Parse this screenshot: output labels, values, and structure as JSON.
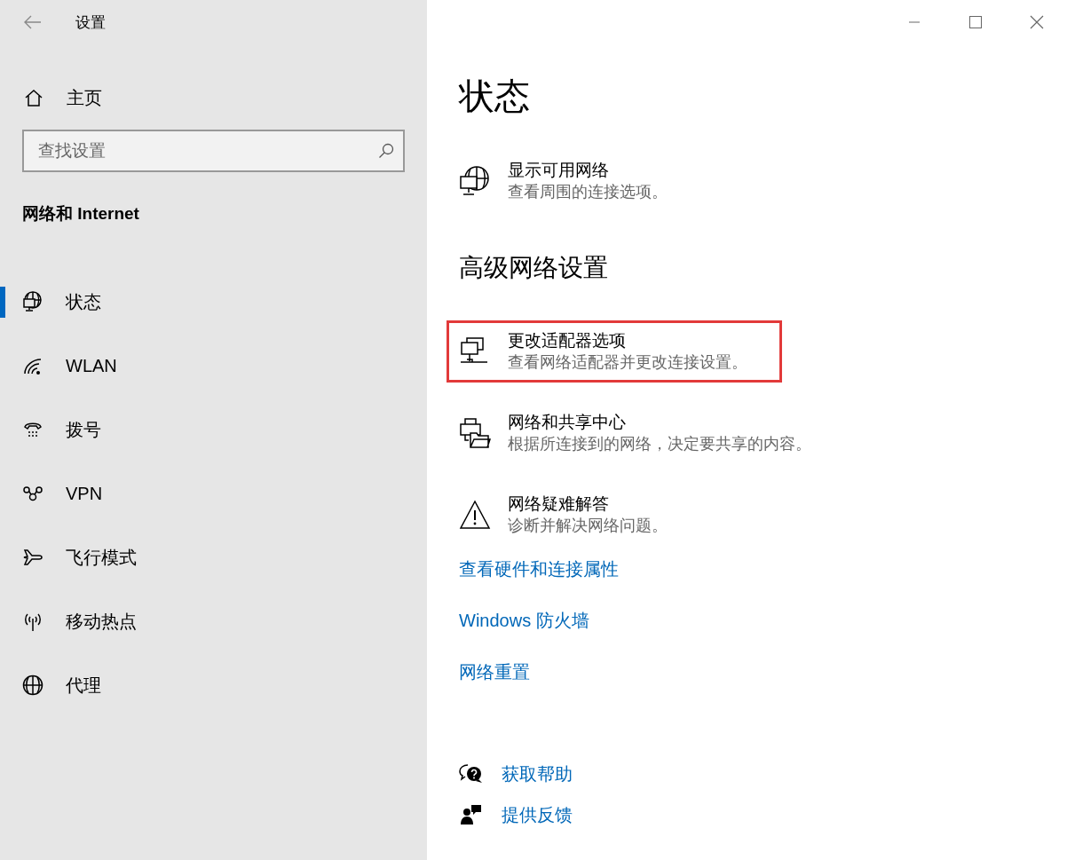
{
  "window": {
    "title": "设置"
  },
  "sidebar": {
    "home": "主页",
    "search": {
      "placeholder": "查找设置"
    },
    "section": "网络和 Internet",
    "items": [
      {
        "label": "状态",
        "selected": true
      },
      {
        "label": "WLAN",
        "selected": false
      },
      {
        "label": "拨号",
        "selected": false
      },
      {
        "label": "VPN",
        "selected": false
      },
      {
        "label": "飞行模式",
        "selected": false
      },
      {
        "label": "移动热点",
        "selected": false
      },
      {
        "label": "代理",
        "selected": false
      }
    ]
  },
  "main": {
    "title": "状态",
    "options": [
      {
        "title": "显示可用网络",
        "description": "查看周围的连接选项。",
        "highlighted": false
      }
    ],
    "advanced_heading": "高级网络设置",
    "advanced_options": [
      {
        "title": "更改适配器选项",
        "description": "查看网络适配器并更改连接设置。",
        "highlighted": true
      },
      {
        "title": "网络和共享中心",
        "description": "根据所连接到的网络，决定要共享的内容。",
        "highlighted": false
      },
      {
        "title": "网络疑难解答",
        "description": "诊断并解决网络问题。",
        "highlighted": false
      }
    ],
    "links": [
      "查看硬件和连接属性",
      "Windows 防火墙",
      "网络重置"
    ],
    "help_links": [
      "获取帮助",
      "提供反馈"
    ]
  }
}
